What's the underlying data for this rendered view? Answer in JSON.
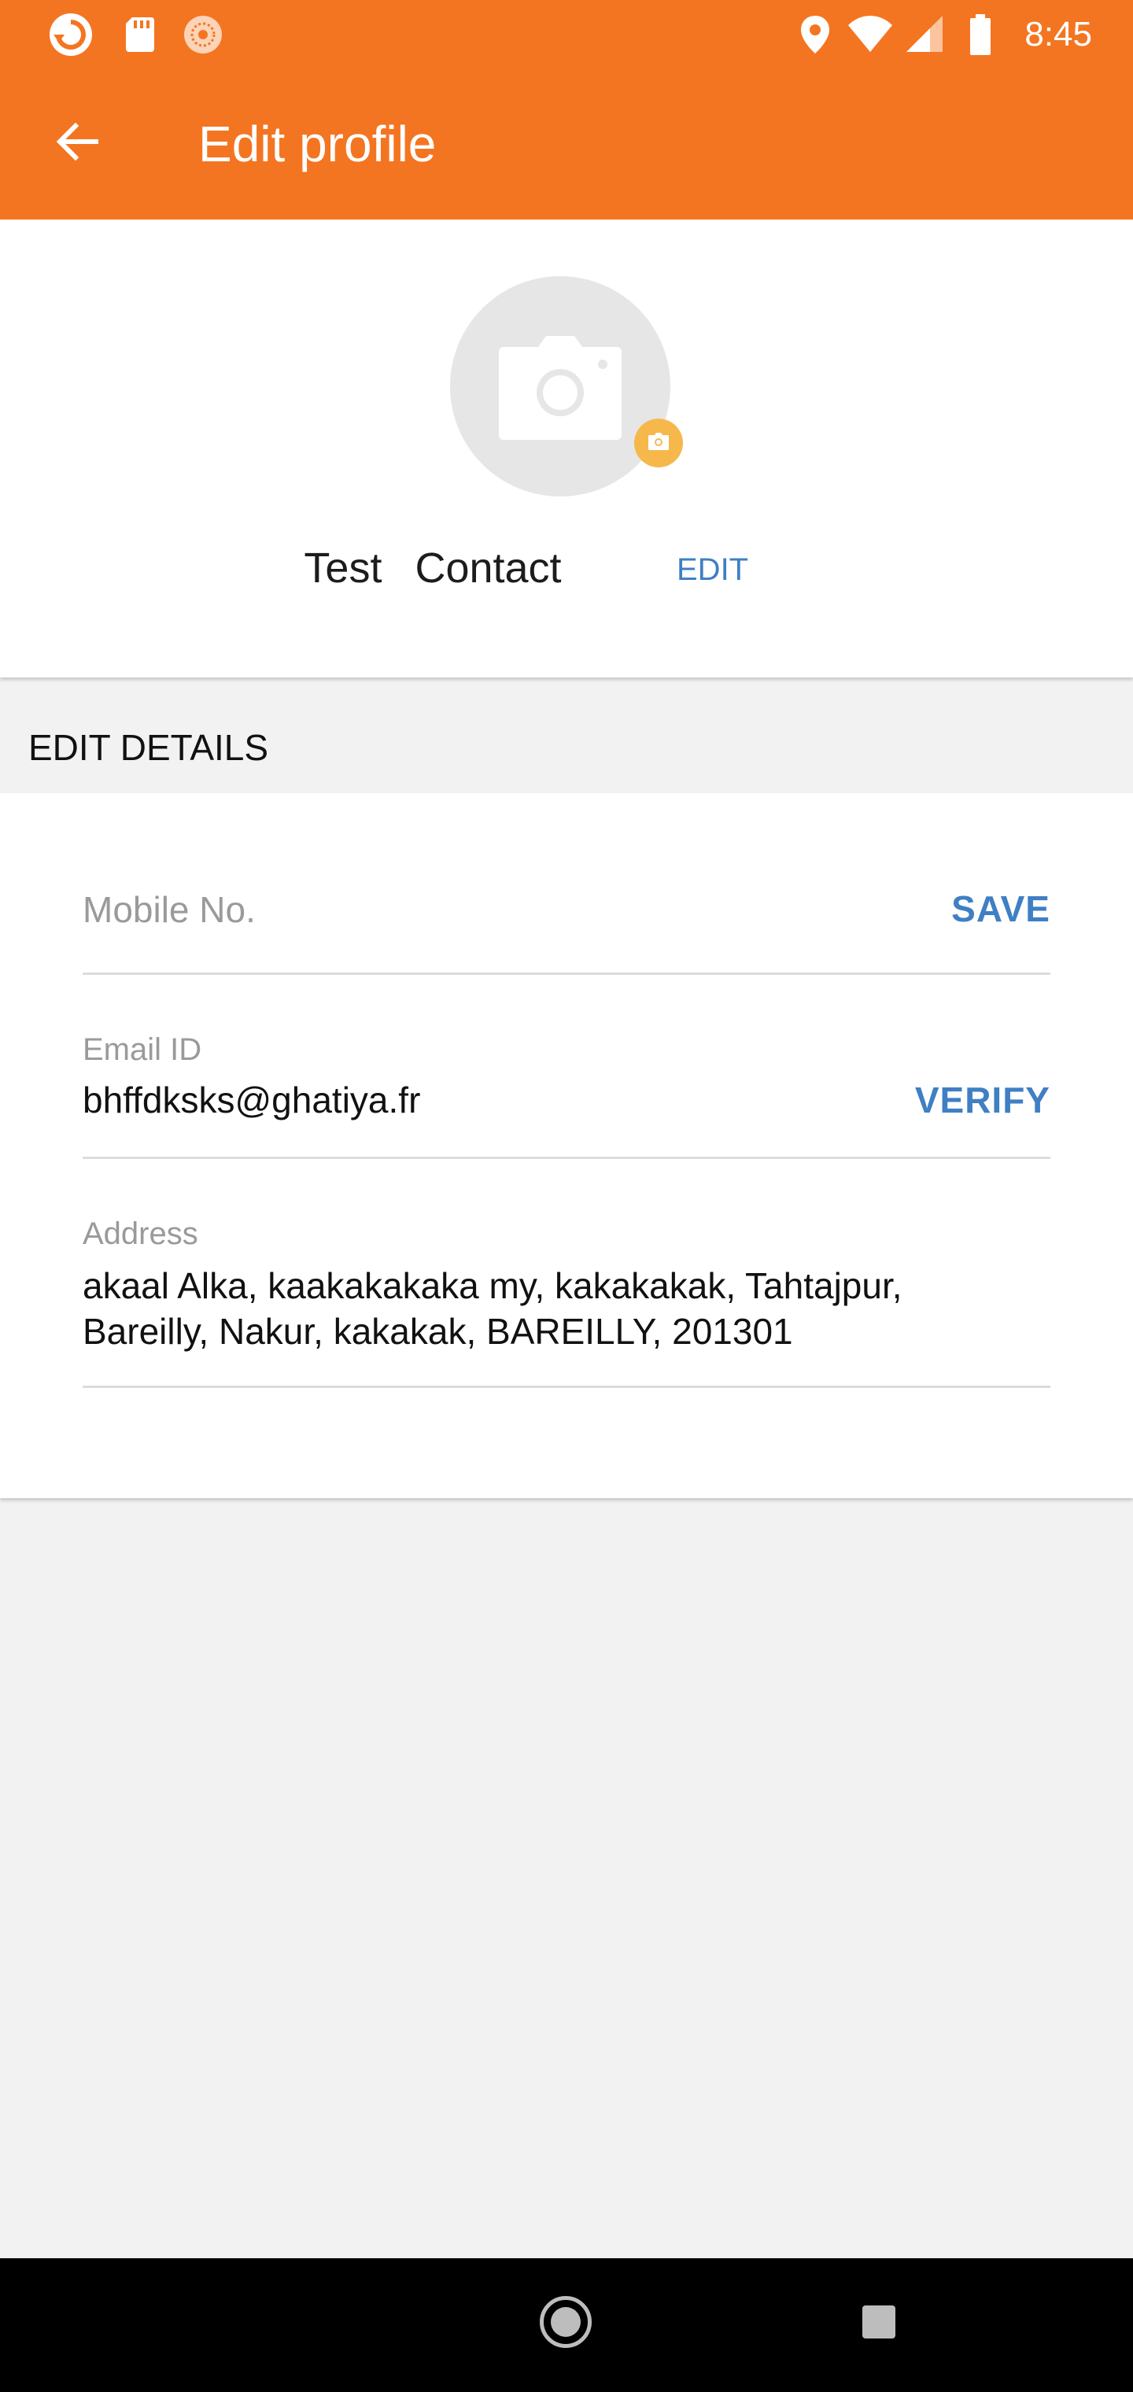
{
  "status_bar": {
    "time": "8:45",
    "icons": [
      "app-refresh-icon",
      "sd-card-icon",
      "sun-icon",
      "location-icon",
      "wifi-icon",
      "signal-icon",
      "battery-icon"
    ]
  },
  "app_bar": {
    "title": "Edit profile",
    "back_icon": "arrow-left-icon",
    "color": "#f47521"
  },
  "profile": {
    "name": "Test  Contact",
    "edit_label": "EDIT",
    "avatar_icon": "camera-icon"
  },
  "edit_details": {
    "section_title": "EDIT DETAILS",
    "mobile": {
      "placeholder": "Mobile No.",
      "value": "",
      "action": "SAVE"
    },
    "email": {
      "label": "Email ID",
      "value": "bhffdksks@ghatiya.fr",
      "action": "VERIFY"
    },
    "address": {
      "label": "Address",
      "line1": "akaal Alka, kaakakakaka my, kakakakak, Tahtajpur,",
      "line2": "Bareilly, Nakur, kakakak, BAREILLY, 201301"
    }
  },
  "colors": {
    "accent": "#f47521",
    "link": "#3f7fc4",
    "badge": "#f6b84b"
  }
}
